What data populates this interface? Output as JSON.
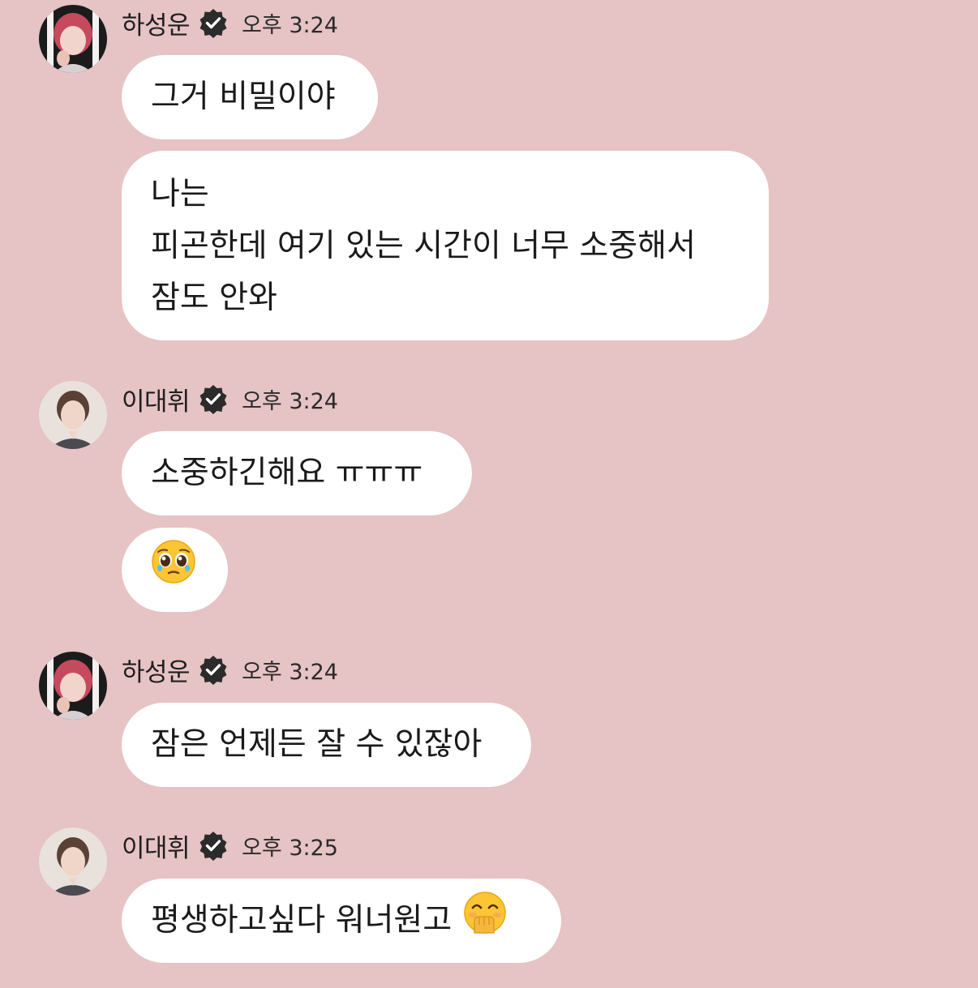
{
  "messages": [
    {
      "sender": "하성운",
      "time": "오후 3:24",
      "bubbles": [
        {
          "lines": [
            "그거 비밀이야"
          ]
        },
        {
          "lines": [
            "나는",
            "피곤한데 여기 있는 시간이 너무 소중해서",
            "잠도 안와"
          ]
        }
      ]
    },
    {
      "sender": "이대휘",
      "time": "오후 3:24",
      "bubbles": [
        {
          "lines": [
            "소중하긴해요 ㅠㅠㅠ"
          ]
        },
        {
          "emoji": "pleading-face-emoji"
        }
      ]
    },
    {
      "sender": "하성운",
      "time": "오후 3:24",
      "bubbles": [
        {
          "lines": [
            "잠은 언제든 잘 수 있잖아"
          ]
        }
      ]
    },
    {
      "sender": "이대휘",
      "time": "오후 3:25",
      "bubbles": [
        {
          "lines": [
            "평생하고싶다 워너원고"
          ],
          "emoji": "hand-over-mouth-emoji"
        }
      ]
    }
  ],
  "icons": {
    "verified": "verified-badge-icon"
  },
  "colors": {
    "background": "#e6c3c4",
    "bubble": "#ffffff",
    "verified_badge": "#2b2b2b"
  }
}
